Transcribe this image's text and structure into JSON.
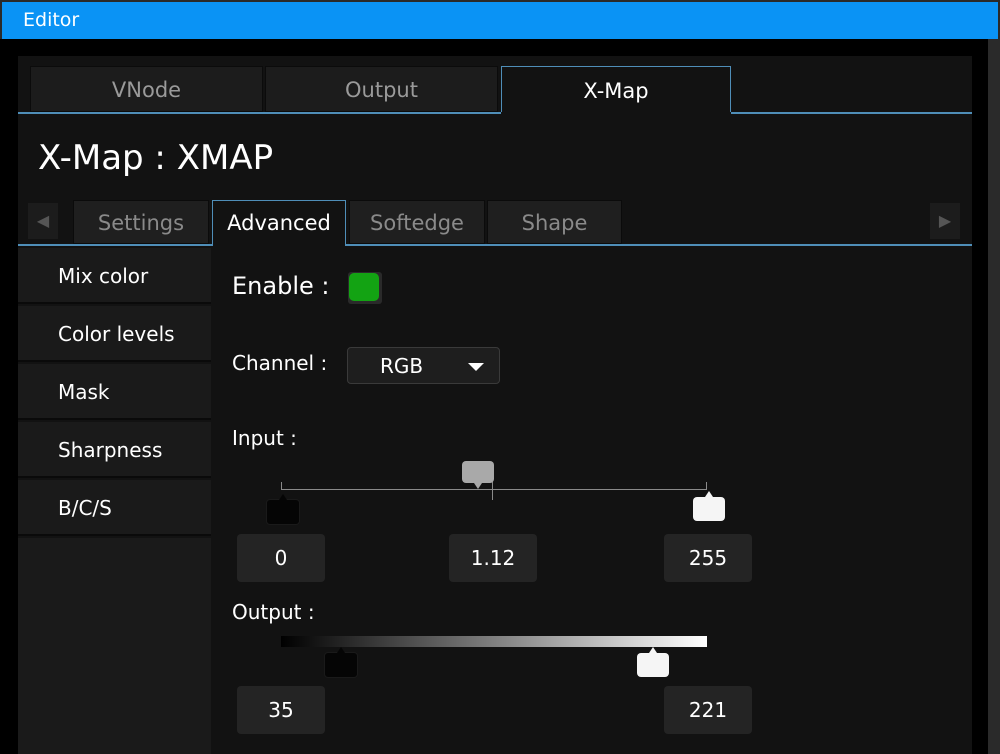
{
  "window": {
    "title": "Editor"
  },
  "top_tabs": [
    {
      "label": "VNode",
      "active": false
    },
    {
      "label": "Output",
      "active": false
    },
    {
      "label": "X-Map",
      "active": true
    }
  ],
  "page_title": "X-Map : XMAP",
  "sub_tabs": [
    {
      "label": "Settings",
      "active": false
    },
    {
      "label": "Advanced",
      "active": true
    },
    {
      "label": "Softedge",
      "active": false
    },
    {
      "label": "Shape",
      "active": false
    }
  ],
  "sidebar": {
    "items": [
      {
        "label": "Mix color"
      },
      {
        "label": "Color levels"
      },
      {
        "label": "Mask"
      },
      {
        "label": "Sharpness"
      },
      {
        "label": "B/C/S"
      }
    ]
  },
  "advanced": {
    "enable_label": "Enable :",
    "enable_checked": true,
    "enable_color": "#13a313",
    "channel_label": "Channel :",
    "channel_value": "RGB",
    "input_label": "Input :",
    "input_low": "0",
    "input_gamma": "1.12",
    "input_high": "255",
    "output_label": "Output :",
    "output_low": "35",
    "output_high": "221"
  },
  "colors": {
    "titlebar": "#0a93f5",
    "tab_accent": "#4f8eb8"
  }
}
